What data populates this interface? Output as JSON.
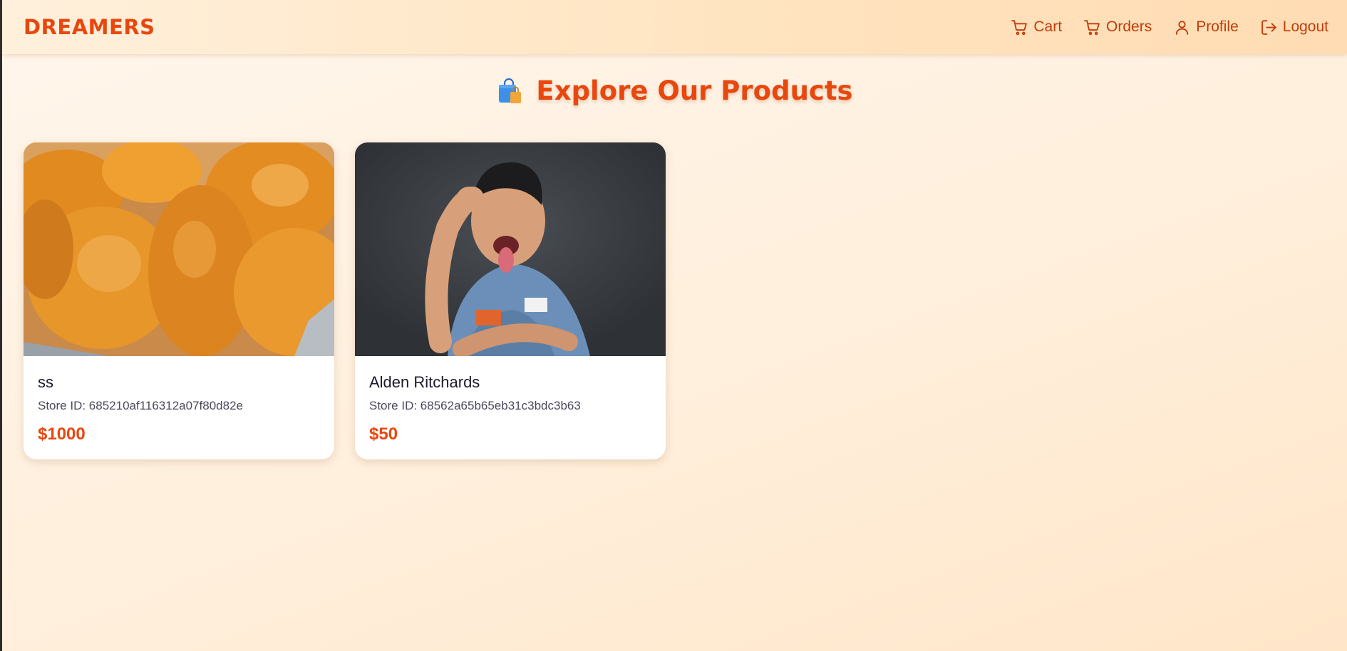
{
  "navbar": {
    "brand": "DREAMERS",
    "links": [
      {
        "label": "Cart",
        "icon": "cart-icon"
      },
      {
        "label": "Orders",
        "icon": "cart-icon"
      },
      {
        "label": "Profile",
        "icon": "user-icon"
      },
      {
        "label": "Logout",
        "icon": "logout-icon"
      }
    ]
  },
  "main": {
    "icon": "shopping-bag-icon",
    "title": "Explore Our Products"
  },
  "products": [
    {
      "name": "ss",
      "store": "Store ID: 685210af116312a07f80d82e",
      "price": "$1000",
      "image": "fried-chicken-photo"
    },
    {
      "name": "Alden Ritchards",
      "store": "Store ID: 68562a65b65eb31c3bdc3b63",
      "price": "$50",
      "image": "person-photo"
    }
  ],
  "colors": {
    "accent": "#e8470e",
    "nav_text": "#c23c0b",
    "card_bg": "#ffffff"
  }
}
